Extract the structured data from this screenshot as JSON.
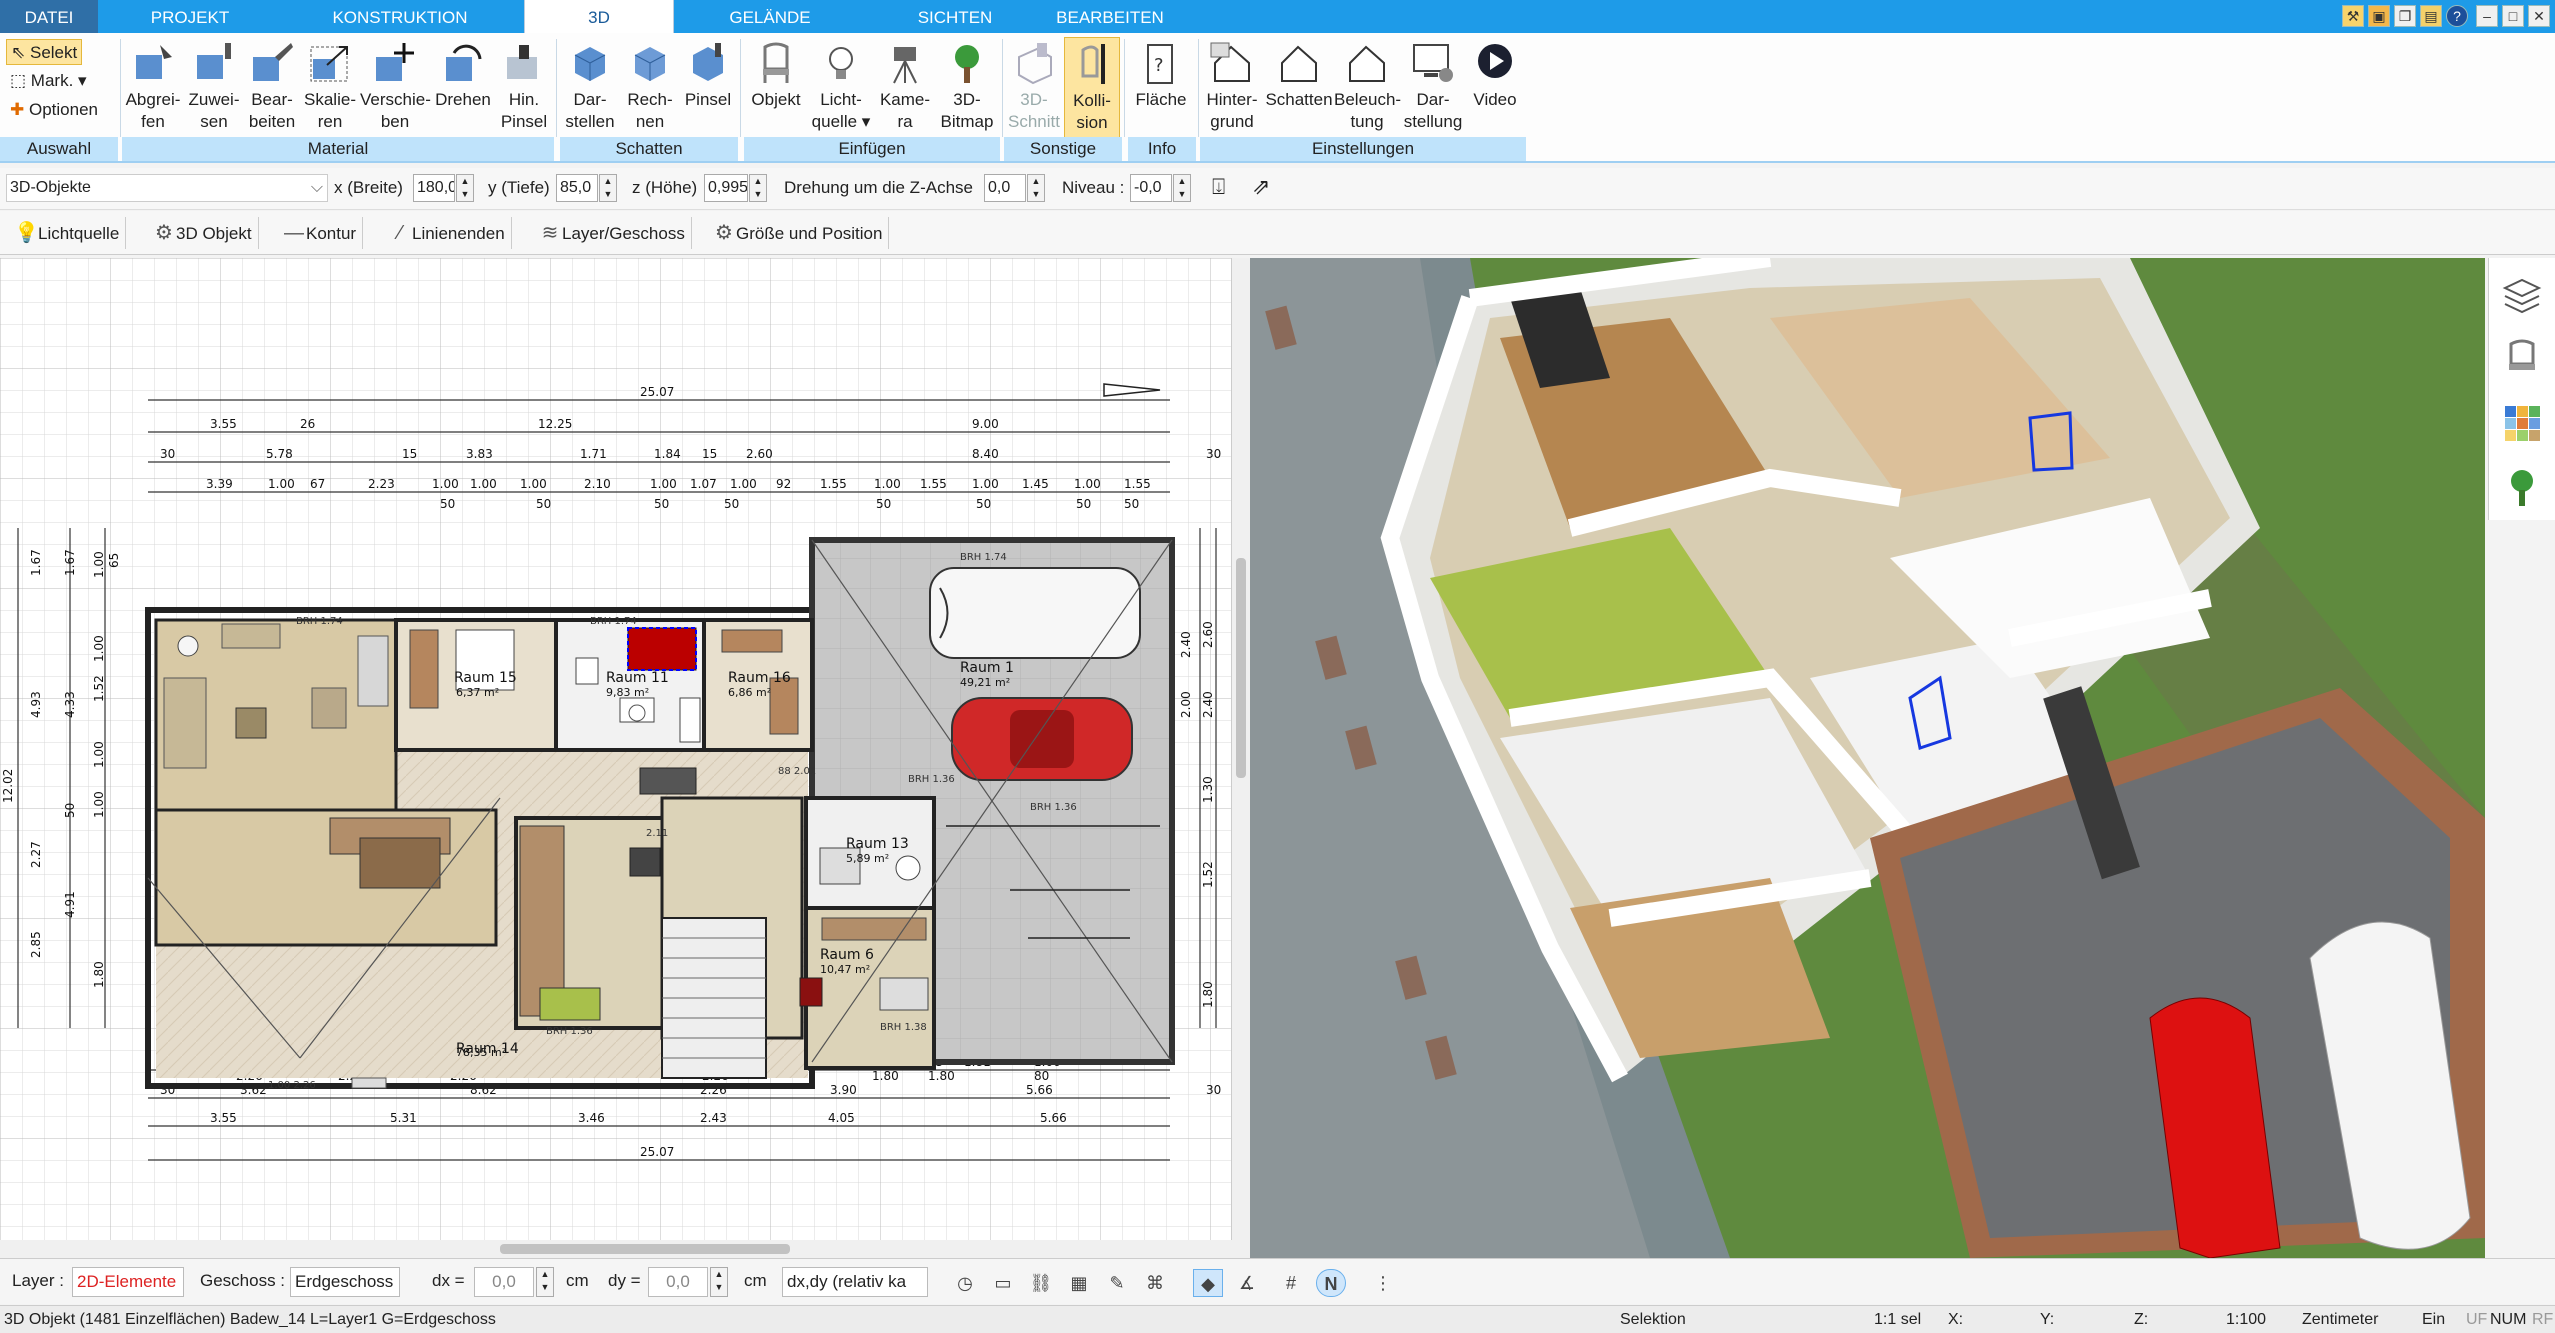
{
  "menu": {
    "tabs": [
      {
        "label": "DATEI"
      },
      {
        "label": "PROJEKT"
      },
      {
        "label": "KONSTRUKTION"
      },
      {
        "label": "3D"
      },
      {
        "label": "GELÄNDE"
      },
      {
        "label": "SICHTEN"
      },
      {
        "label": "BEARBEITEN"
      }
    ],
    "active_tab": "3D",
    "accent_color": "#1e9be8"
  },
  "ribbon": {
    "auswahl": {
      "select": "Selekt",
      "mark": "Mark.",
      "options": "Optionen",
      "group": "Auswahl"
    },
    "material": {
      "group": "Material",
      "buttons": [
        {
          "label": "Abgrei-\nfen"
        },
        {
          "label": "Zuwei-\nsen"
        },
        {
          "label": "Bear-\nbeiten"
        },
        {
          "label": "Skalie-\nren"
        },
        {
          "label": "Verschie-\nben"
        },
        {
          "label": "Drehen"
        },
        {
          "label": "Hin.\nPinsel"
        }
      ]
    },
    "schatten": {
      "group": "Schatten",
      "buttons": [
        {
          "label": "Dar-\nstellen"
        },
        {
          "label": "Rech-\nnen"
        },
        {
          "label": "Pinsel"
        }
      ]
    },
    "einfuegen": {
      "group": "Einfügen",
      "buttons": [
        {
          "label": "Objekt"
        },
        {
          "label": "Licht-\nquelle ▾"
        },
        {
          "label": "Kame-\nra"
        },
        {
          "label": "3D-\nBitmap"
        }
      ]
    },
    "sonstige": {
      "group": "Sonstige",
      "buttons": [
        {
          "label": "3D-\nSchnitt"
        },
        {
          "label": "Kolli-\nsion"
        }
      ]
    },
    "info": {
      "group": "Info",
      "buttons": [
        {
          "label": "Fläche"
        }
      ]
    },
    "einstellungen": {
      "group": "Einstellungen",
      "buttons": [
        {
          "label": "Hinter-\ngrund"
        },
        {
          "label": "Schatten"
        },
        {
          "label": "Beleuch-\ntung"
        },
        {
          "label": "Dar-\nstellung"
        },
        {
          "label": "Video"
        }
      ]
    }
  },
  "props": {
    "object_type": "3D-Objekte",
    "x_label": "x (Breite)",
    "x_value": "180,0",
    "y_label": "y (Tiefe)",
    "y_value": "85,0",
    "z_label": "z (Höhe)",
    "z_value": "0,995",
    "rot_label": "Drehung um die Z-Achse",
    "rot_value": "0,0",
    "niveau_label": "Niveau :",
    "niveau_value": "-0,0"
  },
  "toolbar2": {
    "items": [
      {
        "label": "Lichtquelle"
      },
      {
        "label": "3D Objekt"
      },
      {
        "label": "Kontur"
      },
      {
        "label": "Linienenden"
      },
      {
        "label": "Layer/Geschoss"
      },
      {
        "label": "Größe und Position"
      }
    ]
  },
  "plan": {
    "dims_top": {
      "overall": "25.07",
      "row1": [
        "3.55",
        "26",
        "12.25",
        "9.00"
      ],
      "row2": [
        "30",
        "5.78",
        "15",
        "3.83",
        "1.71",
        "1.84",
        "15",
        "2.60",
        "8.40",
        "30"
      ],
      "row3": [
        "3.39",
        "1.00",
        "67",
        "2.23",
        "1.00",
        "1.00",
        "2.10",
        "1.00",
        "1.07",
        "1.00",
        "92",
        "1.55",
        "1.00",
        "1.55",
        "1.00",
        "1.45",
        "1.00",
        "1.55"
      ],
      "row3b": [
        "50",
        "50",
        "50",
        "50",
        "50",
        "50",
        "50",
        "50"
      ]
    },
    "dims_bottom": {
      "row1": [
        "2.03",
        "1.00",
        "1.45",
        "1.00",
        "1.60",
        "1.00",
        "57",
        "1.00",
        "1.79",
        "1.67",
        "1.00",
        "1.65",
        "1.00",
        "2.16",
        "1.00",
        "05",
        "1.81",
        "1.00"
      ],
      "row1b": [
        "2.26",
        "2.26",
        "2.26",
        "2.26",
        "2.26",
        "1.80",
        "80"
      ],
      "row2": [
        "30",
        "3.62",
        "8.62",
        "2.26",
        "3.90",
        "5.66",
        "30"
      ],
      "row3": [
        "3.55",
        "5.31",
        "3.46",
        "2.43",
        "4.05",
        "5.66"
      ],
      "overall": "25.07"
    },
    "dims_left": [
      "1.67",
      "1.67",
      "1.00",
      "65",
      "4.93",
      "4.33",
      "1.00",
      "1.52",
      "1.00",
      "12.02",
      "1.00",
      "50",
      "2.27",
      "4.91",
      "2.85",
      "1.80"
    ],
    "dims_right": [
      "2.60",
      "2.40",
      "2.00",
      "2.40",
      "1.30",
      "1.52",
      "1.80"
    ],
    "rooms": [
      {
        "name": "Raum 15",
        "area": "6,37 m²"
      },
      {
        "name": "Raum 11",
        "area": "9,83 m²"
      },
      {
        "name": "Raum 16",
        "area": "6,86 m²"
      },
      {
        "name": "Raum 1",
        "area": "49,21 m²"
      },
      {
        "name": "Raum 14",
        "area": "78,35 m²"
      },
      {
        "name": "Raum 13",
        "area": "5,89 m²"
      },
      {
        "name": "Raum 6",
        "area": "10,47 m²"
      }
    ],
    "misc_labels": [
      "BRH 1.74",
      "BRH 1.74",
      "BRH 1.74",
      "BRH 1.36",
      "BRH 1.36",
      "BRH 1.36",
      "1.00 2.26",
      "88 2.01",
      "2.11",
      "BRH 1.38"
    ]
  },
  "bottom": {
    "layer_label": "Layer :",
    "layer_value": "2D-Elemente",
    "geschoss_label": "Geschoss :",
    "geschoss_value": "Erdgeschoss",
    "dx_label": "dx =",
    "dx_value": "0,0",
    "cm1": "cm",
    "dy_label": "dy =",
    "dy_value": "0,0",
    "cm2": "cm",
    "coord_mode": "dx,dy (relativ ka"
  },
  "status": {
    "left": "3D Objekt (1481 Einzelflächen) Badew_14 L=Layer1 G=Erdgeschoss",
    "mode": "Selektion",
    "scale_sel": "1:1 sel",
    "x": "X:",
    "y": "Y:",
    "z": "Z:",
    "scale": "1:100",
    "unit": "Zentimeter",
    "ein": "Ein",
    "uf": "UF",
    "num": "NUM",
    "rf": "RF"
  },
  "colors": {
    "ribbon_group": "#bfe3fb",
    "highlight": "#fde5a0",
    "layer_red": "#d22"
  }
}
